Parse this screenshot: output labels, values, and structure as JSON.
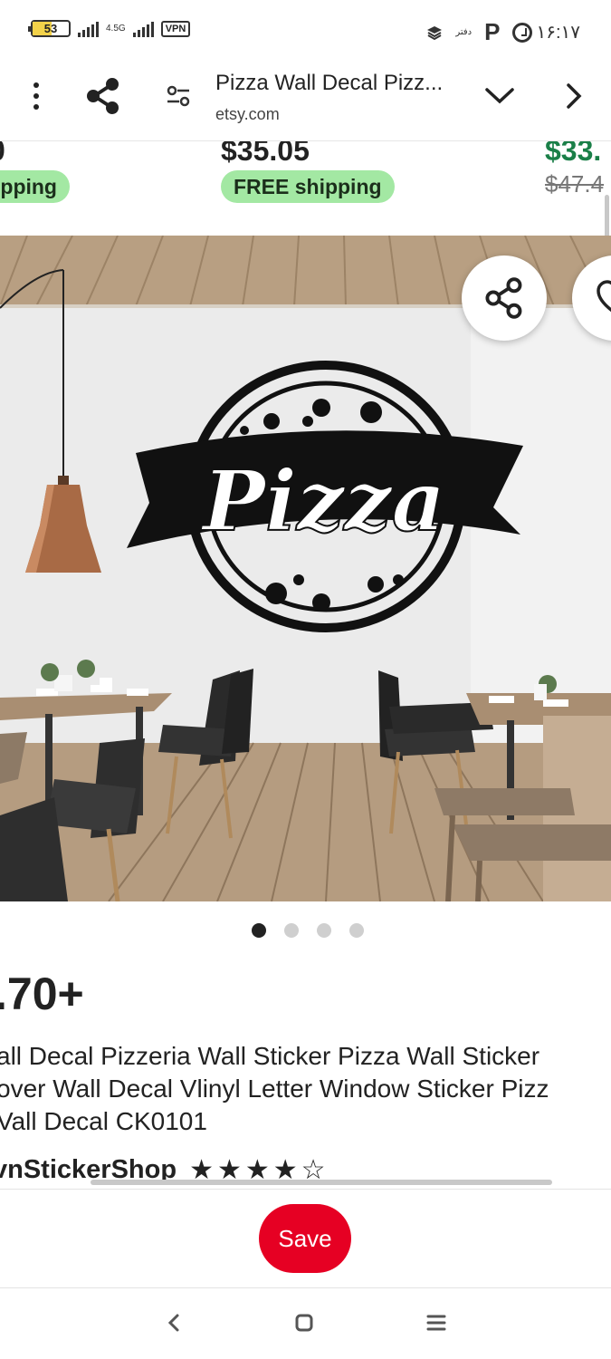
{
  "status_bar": {
    "battery": "53",
    "network_type": "4.5G",
    "vpn": "VPN",
    "data_label": "دفتر",
    "time": "۱۶:۱۷"
  },
  "toolbar": {
    "title": "Pizza Wall Decal Pizz...",
    "url": "etsy.com"
  },
  "related": [
    {
      "price": "0",
      "shipping": "ipping"
    },
    {
      "price": "$35.05",
      "shipping": "FREE shipping"
    },
    {
      "price": "$33.",
      "original": "$47.4"
    }
  ],
  "carousel": {
    "count": 4,
    "active": 0
  },
  "product": {
    "price": ".70+",
    "title_lines": [
      "all Decal Pizzeria Wall Sticker Pizza Wall Sticker",
      "over Wall Decal Vlinyl Letter Window Sticker Pizz",
      "Vall Decal CK0101"
    ],
    "shop": "vnStickerShop",
    "rating": "★★★★☆"
  },
  "save_bar": {
    "save_label": "Save"
  },
  "colors": {
    "accent_red": "#e60023",
    "green_price": "#1a7f48",
    "ship_pill": "#a3e8a3"
  }
}
